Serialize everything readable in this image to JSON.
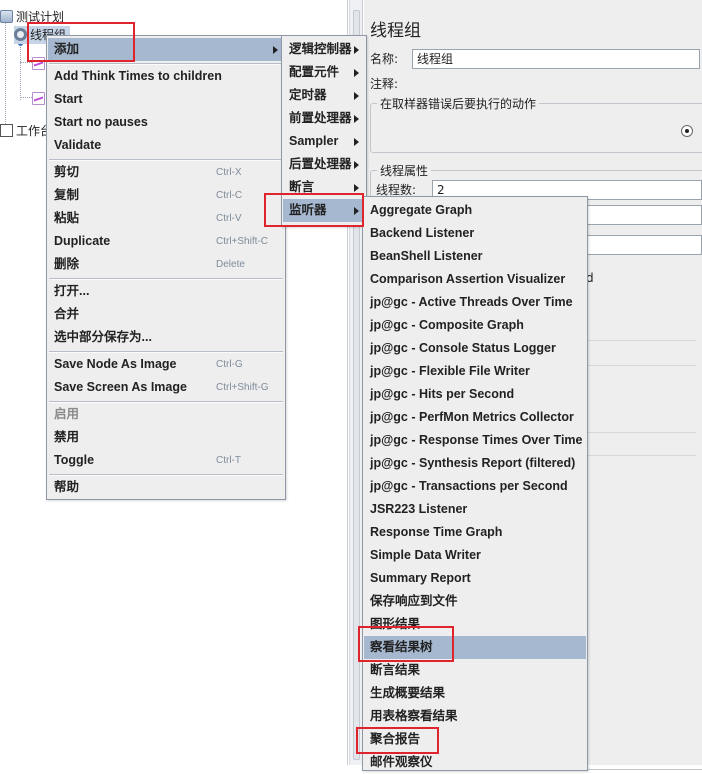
{
  "tree": {
    "test_plan": "测试计划",
    "thread_group": "线程组",
    "workbench": "工作台"
  },
  "right_panel": {
    "title": "线程组",
    "name_label": "名称:",
    "name_value": "线程组",
    "comment_label": "注释:",
    "error_action_legend": "在取样器错误后要执行的动作",
    "thread_props_legend": "线程属性",
    "thread_count_label": "线程数:",
    "thread_count_value": "2",
    "partial_text": "d"
  },
  "context_menu": {
    "items": [
      {
        "label": "添加",
        "submenu": true
      },
      {
        "label": "Add Think Times to children"
      },
      {
        "label": "Start"
      },
      {
        "label": "Start no pauses"
      },
      {
        "label": "Validate"
      },
      {
        "label": "剪切",
        "shortcut": "Ctrl-X"
      },
      {
        "label": "复制",
        "shortcut": "Ctrl-C"
      },
      {
        "label": "粘贴",
        "shortcut": "Ctrl-V"
      },
      {
        "label": "Duplicate",
        "shortcut": "Ctrl+Shift-C"
      },
      {
        "label": "删除",
        "shortcut": "Delete"
      },
      {
        "label": "打开..."
      },
      {
        "label": "合并"
      },
      {
        "label": "选中部分保存为..."
      },
      {
        "label": "Save Node As Image",
        "shortcut": "Ctrl-G"
      },
      {
        "label": "Save Screen As Image",
        "shortcut": "Ctrl+Shift-G"
      },
      {
        "label": "启用",
        "disabled": true
      },
      {
        "label": "禁用"
      },
      {
        "label": "Toggle",
        "shortcut": "Ctrl-T"
      },
      {
        "label": "帮助"
      }
    ]
  },
  "add_submenu": {
    "items": [
      {
        "label": "逻辑控制器"
      },
      {
        "label": "配置元件"
      },
      {
        "label": "定时器"
      },
      {
        "label": "前置处理器"
      },
      {
        "label": "Sampler"
      },
      {
        "label": "后置处理器"
      },
      {
        "label": "断言"
      },
      {
        "label": "监听器"
      }
    ]
  },
  "listener_submenu": {
    "items": [
      {
        "label": "Aggregate Graph"
      },
      {
        "label": "Backend Listener"
      },
      {
        "label": "BeanShell Listener"
      },
      {
        "label": "Comparison Assertion Visualizer"
      },
      {
        "label": "jp@gc - Active Threads Over Time"
      },
      {
        "label": "jp@gc - Composite Graph"
      },
      {
        "label": "jp@gc - Console Status Logger"
      },
      {
        "label": "jp@gc - Flexible File Writer"
      },
      {
        "label": "jp@gc - Hits per Second"
      },
      {
        "label": "jp@gc - PerfMon Metrics Collector"
      },
      {
        "label": "jp@gc - Response Times Over Time"
      },
      {
        "label": "jp@gc - Synthesis Report (filtered)"
      },
      {
        "label": "jp@gc - Transactions per Second"
      },
      {
        "label": "JSR223 Listener"
      },
      {
        "label": "Response Time Graph"
      },
      {
        "label": "Simple Data Writer"
      },
      {
        "label": "Summary Report"
      },
      {
        "label": "保存响应到文件"
      },
      {
        "label": "图形结果"
      },
      {
        "label": "察看结果树"
      },
      {
        "label": "断言结果"
      },
      {
        "label": "生成概要结果"
      },
      {
        "label": "用表格察看结果"
      },
      {
        "label": "聚合报告"
      },
      {
        "label": "邮件观察仪"
      }
    ]
  },
  "colors": {
    "selection": "#a5b8d0",
    "annotation": "#e0242e",
    "menu_bg": "#eeeeee"
  }
}
